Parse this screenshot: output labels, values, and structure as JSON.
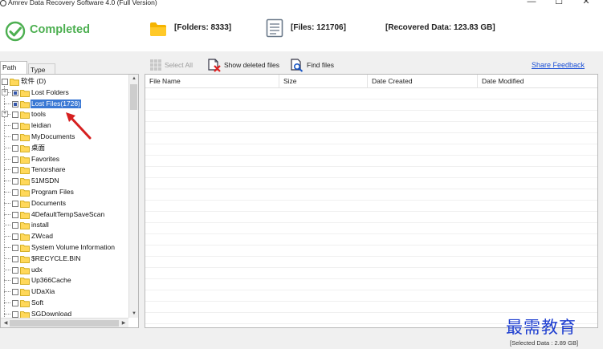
{
  "window": {
    "title": "Amrev Data Recovery Software 4.0 (Full Version)",
    "min_glyph": "—",
    "max_glyph": "☐",
    "close_glyph": "✕"
  },
  "status": {
    "text": "Completed",
    "folders": "[Folders: 8333]",
    "files": "[Files: 121706]",
    "recovered": "[Recovered Data: 123.83 GB]",
    "color": "#4caf50"
  },
  "tabs": [
    {
      "label": "Path"
    },
    {
      "label": "Type"
    }
  ],
  "toolbar": {
    "select_all": "Select All",
    "show_deleted": "Show deleted files",
    "find_files": "Find files",
    "share_feedback": "Share Feedback"
  },
  "tree": {
    "items": [
      {
        "label": "软件 (D)",
        "icon": "folder-icon",
        "selected": false
      },
      {
        "label": "Lost Folders",
        "icon": "folder-icon",
        "selected": false
      },
      {
        "label": "Lost Files(1728)",
        "icon": "folder-icon",
        "selected": true
      },
      {
        "label": "tools",
        "icon": "folder-icon",
        "selected": false
      },
      {
        "label": "leidian",
        "icon": "folder-icon",
        "selected": false
      },
      {
        "label": "MyDocuments",
        "icon": "folder-icon",
        "selected": false
      },
      {
        "label": "桌面",
        "icon": "folder-icon",
        "selected": false
      },
      {
        "label": "Favorites",
        "icon": "folder-icon",
        "selected": false
      },
      {
        "label": "Tenorshare",
        "icon": "folder-icon",
        "selected": false
      },
      {
        "label": "51MSDN",
        "icon": "folder-icon",
        "selected": false
      },
      {
        "label": "Program Files",
        "icon": "folder-icon",
        "selected": false
      },
      {
        "label": "Documents",
        "icon": "folder-icon",
        "selected": false
      },
      {
        "label": "4DefaultTempSaveScan",
        "icon": "folder-icon",
        "selected": false
      },
      {
        "label": "install",
        "icon": "folder-icon",
        "selected": false
      },
      {
        "label": "ZWcad",
        "icon": "folder-icon",
        "selected": false
      },
      {
        "label": "System Volume Information",
        "icon": "folder-icon",
        "selected": false
      },
      {
        "label": "$RECYCLE.BIN",
        "icon": "folder-icon",
        "selected": false
      },
      {
        "label": "udx",
        "icon": "folder-icon",
        "selected": false
      },
      {
        "label": "Up366Cache",
        "icon": "folder-icon",
        "selected": false
      },
      {
        "label": "UDaXia",
        "icon": "folder-icon",
        "selected": false
      },
      {
        "label": "Soft",
        "icon": "folder-icon",
        "selected": false
      },
      {
        "label": "SGDownload",
        "icon": "folder-icon",
        "selected": false
      }
    ]
  },
  "list": {
    "columns": [
      {
        "label": "File Name"
      },
      {
        "label": "Size"
      },
      {
        "label": "Date Created"
      },
      {
        "label": "Date Modified"
      }
    ]
  },
  "watermark": "最需教育",
  "footer": {
    "selected_data": "[Selected Data : 2.89 GB]"
  }
}
